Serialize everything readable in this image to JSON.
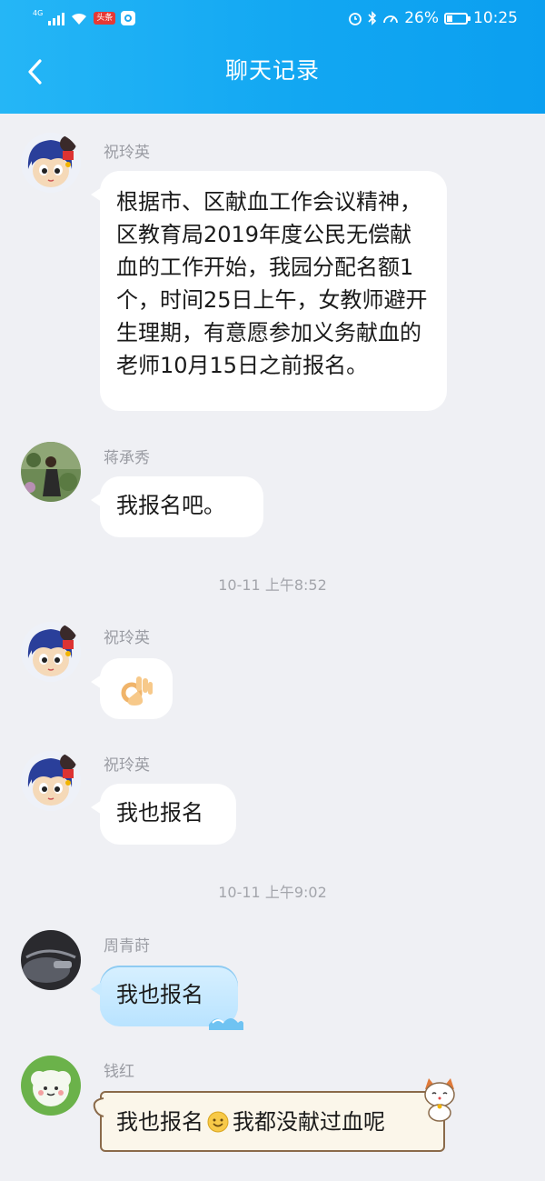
{
  "status_bar": {
    "signal_label": "4G",
    "app_badge": "头条",
    "battery": "26%",
    "time": "10:25"
  },
  "header": {
    "title": "聊天记录"
  },
  "messages": [
    {
      "sender": "祝玲英",
      "text": "根据市、区献血工作会议精神，区教育局2019年度公民无偿献血的工作开始，我园分配名额1个，时间25日上午，女教师避开生理期，有意愿参加义务献血的老师10月15日之前报名。"
    },
    {
      "sender": "蒋承秀",
      "text": "我报名吧。"
    },
    {
      "sender": "祝玲英",
      "emoji": "ok-hand-emoji"
    },
    {
      "sender": "祝玲英",
      "text": "我也报名"
    },
    {
      "sender": "周青莳",
      "text": "我也报名"
    },
    {
      "sender": "钱红",
      "text_a": "我也报名",
      "text_b": "我都没献过血呢"
    }
  ],
  "timestamps": [
    "10-11 上午8:52",
    "10-11 上午9:02"
  ],
  "colors": {
    "header": "#12a7f2",
    "background": "#eff0f4",
    "bubble": "#ffffff",
    "sender": "#9a9ca3"
  }
}
